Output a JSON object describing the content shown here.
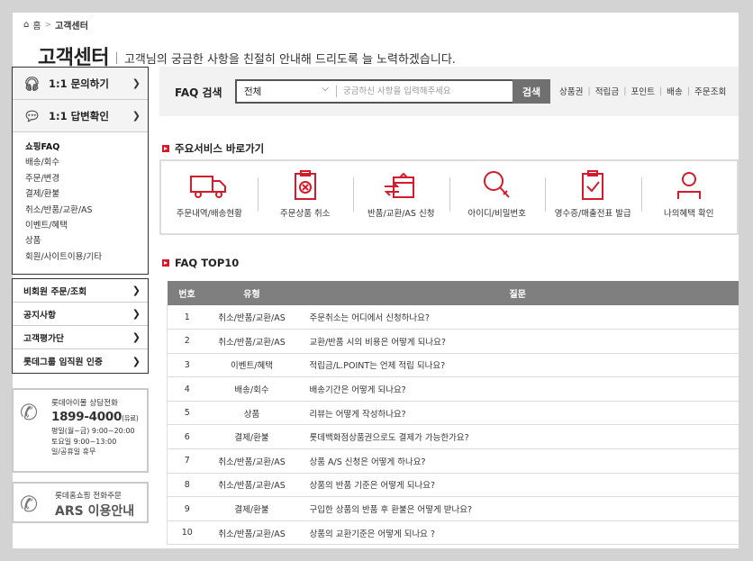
{
  "breadcrumb": {
    "home": "홈",
    "current": "고객센터"
  },
  "header": {
    "title": "고객센터",
    "subtitle": "고객님의 궁금한 사항을 친절히 안내해 드리도록 늘 노력하겠습니다."
  },
  "sidebar": {
    "inquiry_label": "1:1 문의하기",
    "answer_label": "1:1 답변확인",
    "faq_categories": [
      "쇼핑FAQ",
      "배송/회수",
      "주문/변경",
      "결제/환불",
      "취소/반품/교환/AS",
      "이벤트/혜택",
      "상품",
      "회원/사이트이용/기타"
    ],
    "links": [
      "비회원 주문/조회",
      "공지사항",
      "고객평가단",
      "롯데그룹 임직원 인증"
    ],
    "call_center": {
      "title": "롯데아이몰 상담전화",
      "number": "1899-4000",
      "number_note": "(유료)",
      "hours": [
        "평일(월~금) 9:00~20:00",
        "토요일 9:00~13:00",
        "일/공휴일 휴무"
      ]
    },
    "ars": {
      "title": "롯데홈쇼핑 전화주문",
      "label": "ARS 이용안내"
    }
  },
  "search": {
    "label": "FAQ 검색",
    "select_value": "전체",
    "placeholder": "궁금하신 사항을 입력해주세요",
    "button": "검색",
    "quick_links": [
      "상품권",
      "적립금",
      "포인트",
      "배송",
      "주문조회"
    ]
  },
  "services": {
    "title": "주요서비스 바로가기",
    "items": [
      {
        "label": "주문내역/배송현황",
        "icon": "truck-icon"
      },
      {
        "label": "주문상품 취소",
        "icon": "cancel-clipboard-icon"
      },
      {
        "label": "반품/교환/AS 신청",
        "icon": "exchange-box-icon"
      },
      {
        "label": "아이디/비밀번호",
        "icon": "search-key-icon"
      },
      {
        "label": "영수증/매출전표 발급",
        "icon": "receipt-check-icon"
      },
      {
        "label": "나의혜택 확인",
        "icon": "user-icon"
      }
    ]
  },
  "faq_top": {
    "title": "FAQ TOP10",
    "columns": [
      "번호",
      "유형",
      "질문"
    ],
    "rows": [
      {
        "no": "1",
        "type": "취소/반품/교환/AS",
        "question": "주문취소는 어디에서 신청하나요?"
      },
      {
        "no": "2",
        "type": "취소/반품/교환/AS",
        "question": "교환/반품 시의 비용은 어떻게 되나요?"
      },
      {
        "no": "3",
        "type": "이벤트/혜택",
        "question": "적립금/L.POINT는 언제 적립 되나요?"
      },
      {
        "no": "4",
        "type": "배송/회수",
        "question": "배송기간은 어떻게 되나요?"
      },
      {
        "no": "5",
        "type": "상품",
        "question": "리뷰는 어떻게 작성하나요?"
      },
      {
        "no": "6",
        "type": "결제/환불",
        "question": "롯데백화점상품권으로도 결제가 가능한가요?"
      },
      {
        "no": "7",
        "type": "취소/반품/교환/AS",
        "question": "상품 A/S 신청은 어떻게 하나요?"
      },
      {
        "no": "8",
        "type": "취소/반품/교환/AS",
        "question": "상품의 반품 기준은 어떻게 되나요?"
      },
      {
        "no": "9",
        "type": "결제/환불",
        "question": "구입한 상품의 반품 후 환불은 어떻게 받나요?"
      },
      {
        "no": "10",
        "type": "취소/반품/교환/AS",
        "question": "상품의 교환기준은 어떻게 되나요 ?"
      }
    ]
  },
  "colors": {
    "accent": "#d71a2b",
    "header_gray": "#7f7f7f"
  }
}
